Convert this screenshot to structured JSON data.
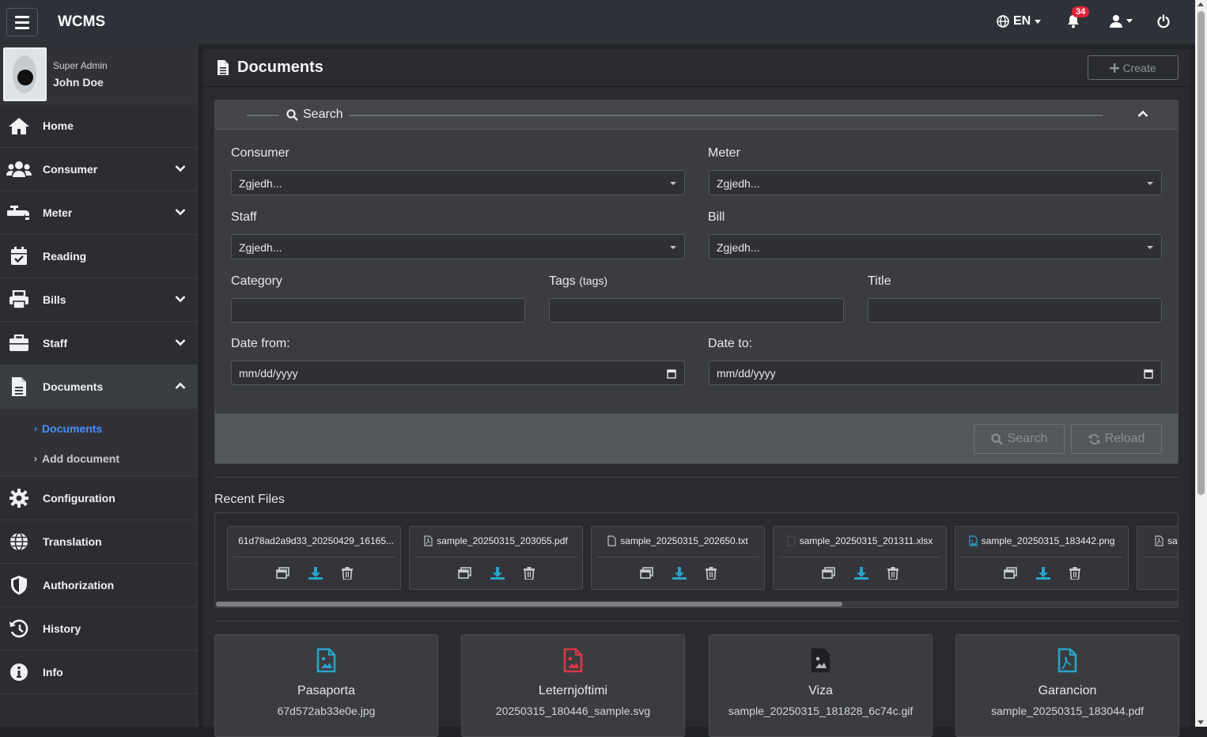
{
  "app": {
    "brand": "WCMS"
  },
  "topbar": {
    "language": "EN",
    "notification_count": "34"
  },
  "profile": {
    "role": "Super Admin",
    "name": "John Doe"
  },
  "sidebar": {
    "items": [
      {
        "label": "Home",
        "icon": "home-icon"
      },
      {
        "label": "Consumer",
        "icon": "users-icon"
      },
      {
        "label": "Meter",
        "icon": "faucet-icon"
      },
      {
        "label": "Reading",
        "icon": "calendar-check-icon"
      },
      {
        "label": "Bills",
        "icon": "printer-icon"
      },
      {
        "label": "Staff",
        "icon": "briefcase-icon"
      },
      {
        "label": "Documents",
        "icon": "document-icon"
      },
      {
        "label": "Configuration",
        "icon": "gear-icon"
      },
      {
        "label": "Translation",
        "icon": "globe-icon"
      },
      {
        "label": "Authorization",
        "icon": "shield-icon"
      },
      {
        "label": "History",
        "icon": "history-icon"
      },
      {
        "label": "Info",
        "icon": "info-icon"
      }
    ],
    "documents_sub": [
      {
        "label": "Documents"
      },
      {
        "label": "Add document"
      }
    ]
  },
  "page": {
    "title": "Documents",
    "create_label": "Create"
  },
  "search": {
    "legend": "Search",
    "consumer_label": "Consumer",
    "consumer_value": "Zgjedh...",
    "meter_label": "Meter",
    "meter_value": "Zgjedh...",
    "staff_label": "Staff",
    "staff_value": "Zgjedh...",
    "bill_label": "Bill",
    "bill_value": "Zgjedh...",
    "category_label": "Category",
    "tags_label": "Tags",
    "tags_hint": "(tags)",
    "title_label": "Title",
    "date_from_label": "Date from:",
    "date_from_value": "mm/dd/yyyy",
    "date_to_label": "Date to:",
    "date_to_value": "mm/dd/yyyy",
    "search_button": "Search",
    "reload_button": "Reload"
  },
  "recent": {
    "title": "Recent Files",
    "files": [
      {
        "name": "61d78ad2a9d33_20250429_16165...",
        "icon": "file-image-icon"
      },
      {
        "name": "sample_20250315_203055.pdf",
        "icon": "file-pdf-icon"
      },
      {
        "name": "sample_20250315_202650.txt",
        "icon": "file-icon"
      },
      {
        "name": "sample_20250315_201311.xlsx",
        "icon": "file-icon"
      },
      {
        "name": "sample_20250315_183442.png",
        "icon": "file-image-icon"
      },
      {
        "name": "sa",
        "icon": "file-pdf-icon"
      }
    ]
  },
  "documents": [
    {
      "title": "Pasaporta",
      "file": "67d572ab33e0e.jpg",
      "icon": "file-image-icon",
      "color": "#2aa3c8"
    },
    {
      "title": "Leternjoftimi",
      "file": "20250315_180446_sample.svg",
      "icon": "file-image-icon",
      "color": "#d93848"
    },
    {
      "title": "Viza",
      "file": "sample_20250315_181828_6c74c.gif",
      "icon": "file-image-icon",
      "color": "#b8babd"
    },
    {
      "title": "Garancion",
      "file": "sample_20250315_183044.pdf",
      "icon": "file-pdf-icon",
      "color": "#2aa3c8"
    }
  ],
  "colors": {
    "accent": "#4a8eff",
    "badge": "#e0243b",
    "download": "#2aa3c8"
  }
}
